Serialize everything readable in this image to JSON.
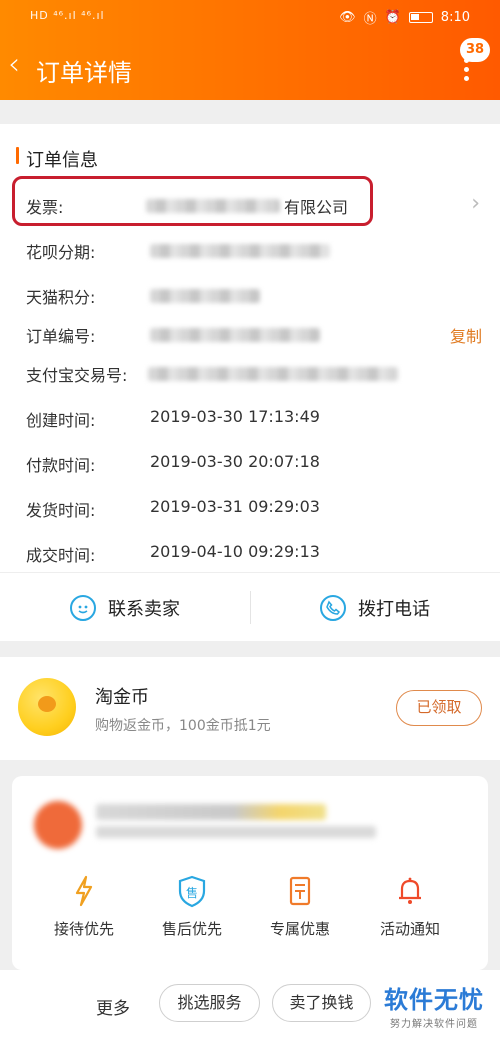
{
  "colors": {
    "brand": "#ff6a00",
    "accent_copy": "#e07b22",
    "highlight_box": "#c81e2e",
    "icon_blue": "#29a7e1"
  },
  "status_bar": {
    "left": "HD ⁴⁶.ıl ⁴⁶.ıl",
    "time": "8:10"
  },
  "header": {
    "title": "订单详情",
    "badge": "38"
  },
  "order_info": {
    "title": "订单信息",
    "rows": [
      {
        "label": "发票:",
        "value": "有限公司"
      },
      {
        "label": "花呗分期:",
        "value": ""
      },
      {
        "label": "天猫积分:",
        "value": ""
      },
      {
        "label": "订单编号:",
        "value": "",
        "action": "复制"
      },
      {
        "label": "支付宝交易号:",
        "value": ""
      },
      {
        "label": "创建时间:",
        "value": "2019-03-30 17:13:49"
      },
      {
        "label": "付款时间:",
        "value": "2019-03-30 20:07:18"
      },
      {
        "label": "发货时间:",
        "value": "2019-03-31 09:29:03"
      },
      {
        "label": "成交时间:",
        "value": "2019-04-10 09:29:13"
      }
    ],
    "actions": {
      "contact_seller": "联系卖家",
      "call": "拨打电话"
    }
  },
  "coin": {
    "title": "淘金币",
    "subtitle": "购物返金币，100金币抵1元",
    "button": "已领取"
  },
  "perks": [
    {
      "icon": "lightning-icon",
      "label": "接待优先"
    },
    {
      "icon": "after-sale-shield-icon",
      "label": "售后优先"
    },
    {
      "icon": "coupon-icon",
      "label": "专属优惠"
    },
    {
      "icon": "bell-icon",
      "label": "活动通知"
    }
  ],
  "bottom_bar": {
    "more": "更多",
    "select_service": "挑选服务",
    "sell_for_cash": "卖了换钱"
  },
  "watermark": {
    "title": "软件无忧",
    "subtitle": "努力解决软件问题"
  }
}
